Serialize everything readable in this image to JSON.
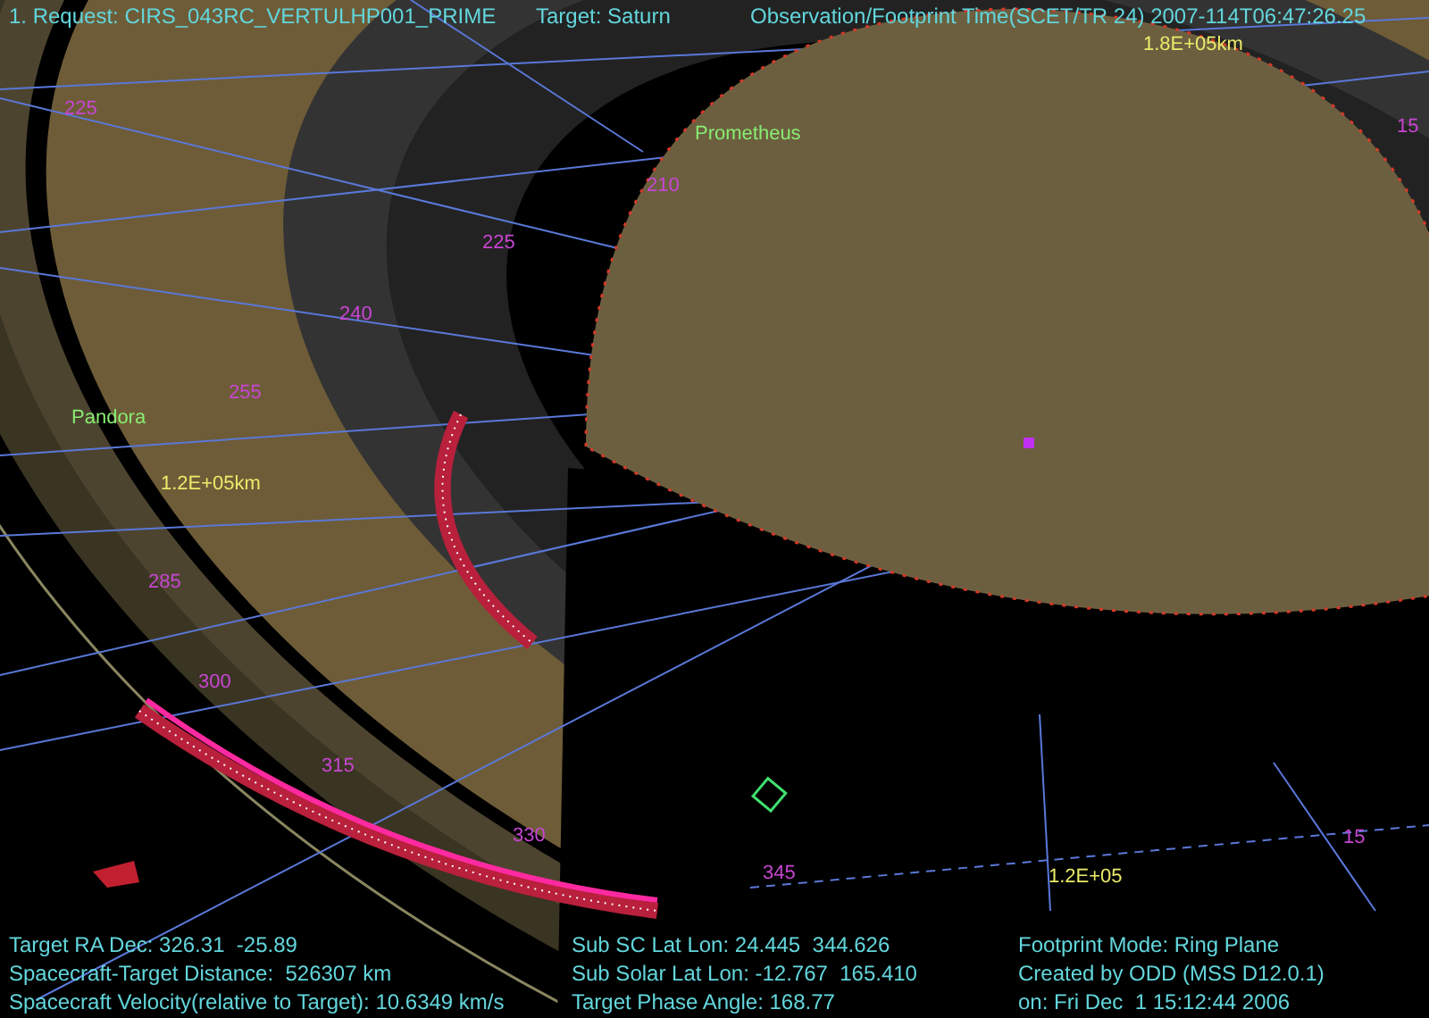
{
  "header": {
    "request": "1. Request: CIRS_043RC_VERTULHP001_PRIME",
    "target": "Target: Saturn",
    "time": "Observation/Footprint Time(SCET/TR 24) 2007-114T06:47:26.25"
  },
  "longitude_labels": [
    "225",
    "210",
    "225",
    "240",
    "255",
    "285",
    "300",
    "315",
    "330",
    "345",
    "15",
    "15"
  ],
  "moon_labels": [
    "Prometheus",
    "Pandora"
  ],
  "distance_labels": [
    "1.8E+05km",
    "1.2E+05km",
    "1.2E+05"
  ],
  "info_columns": [
    [
      "Target RA Dec: 326.31  -25.89",
      "Spacecraft-Target Distance:  526307 km",
      "Spacecraft Velocity(relative to Target): 10.6349 km/s"
    ],
    [
      "Sub SC Lat Lon: 24.445  344.626",
      "Sub Solar Lat Lon: -12.767  165.410",
      "Target Phase Angle: 168.77"
    ],
    [
      "Footprint Mode: Ring Plane",
      "Created by ODD (MSS D12.0.1)",
      "on: Fri Dec  1 15:12:44 2006"
    ]
  ]
}
